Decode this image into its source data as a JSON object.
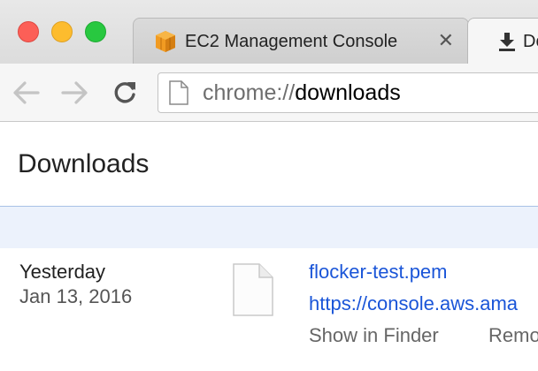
{
  "browser": {
    "tabs": [
      {
        "title": "EC2 Management Console",
        "close": "✕",
        "active": false
      },
      {
        "title": "Do",
        "active": true
      }
    ],
    "address": {
      "scheme": "chrome://",
      "path": "downloads"
    }
  },
  "page": {
    "title": "Downloads",
    "downloads": [
      {
        "date_label": "Yesterday",
        "date": "Jan 13, 2016",
        "file_name": "flocker-test.pem",
        "url": "https://console.aws.ama",
        "actions": {
          "show": "Show in Finder",
          "remove": "Remo"
        }
      }
    ]
  },
  "colors": {
    "link": "#1a55d8",
    "search_band": "#ecf2fc",
    "close": "#fc5f57",
    "minimize": "#fdbc2e",
    "zoom": "#28c840"
  }
}
